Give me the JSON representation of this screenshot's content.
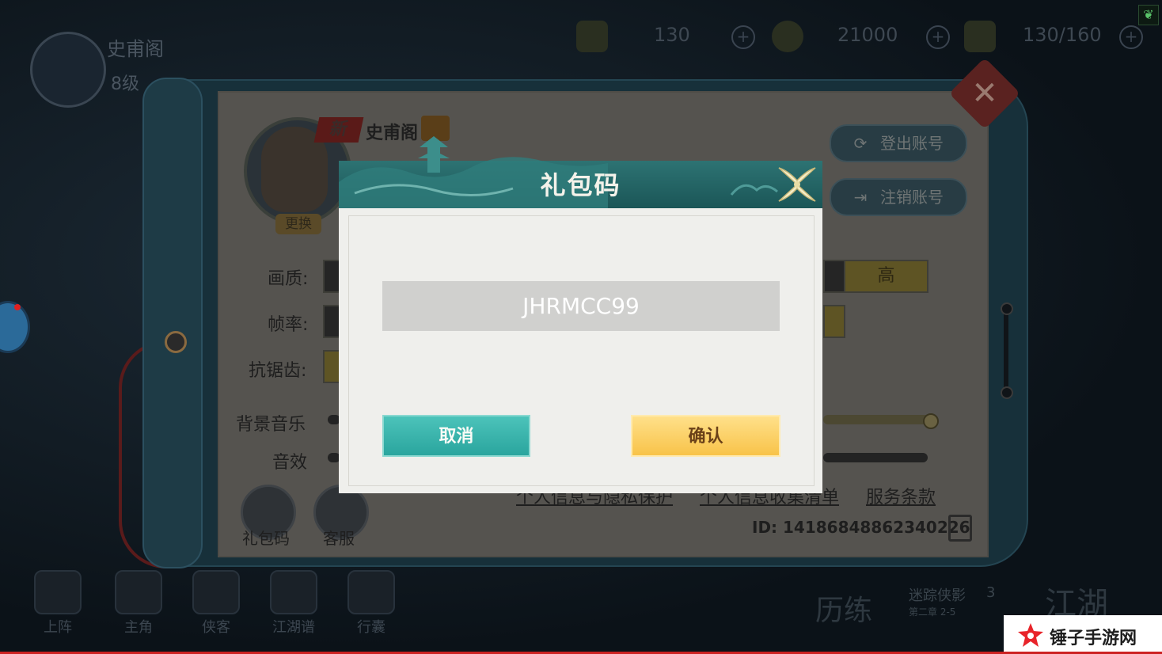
{
  "hud": {
    "player_name": "史甫阁",
    "player_level": "8级",
    "resources": [
      "130",
      "21000",
      "130/160"
    ]
  },
  "bottom_nav": [
    {
      "label": "上阵"
    },
    {
      "label": "主角"
    },
    {
      "label": "侠客"
    },
    {
      "label": "江湖谱"
    },
    {
      "label": "行囊"
    }
  ],
  "bottom_right": {
    "lilian": "历练",
    "jianghu": "江湖",
    "stage_text": "迷踪侠影",
    "stage_count": "3",
    "stage_sub": "第二章 2-5"
  },
  "settings": {
    "new_tag": "新",
    "profile_name": "史甫阁",
    "change_label": "更换",
    "logout_label": "登出账号",
    "delete_label": "注销账号",
    "quality_label": "画质:",
    "quality_selected": "高",
    "framerate_label": "帧率:",
    "antialias_label": "抗锯齿:",
    "music_label": "背景音乐",
    "sfx_label": "音效",
    "music_level": 1.0,
    "sfx_level": 1.0,
    "gift_code_label": "礼包码",
    "support_label": "客服",
    "privacy_link": "个人信息与隐私保护",
    "collection_link": "个人信息收集清单",
    "terms_link": "服务条款",
    "id_text": "ID: 14186848862340226"
  },
  "dialog": {
    "title": "礼包码",
    "code_value": "JHRMCC99",
    "cancel_label": "取消",
    "confirm_label": "确认"
  },
  "watermark": {
    "text": "锤子手游网"
  },
  "colors": {
    "dialog_header": "#1f5e5f",
    "cancel_button": "#36b2aa",
    "confirm_button": "#fbcd5e",
    "watermark_star": "#e8242a"
  }
}
